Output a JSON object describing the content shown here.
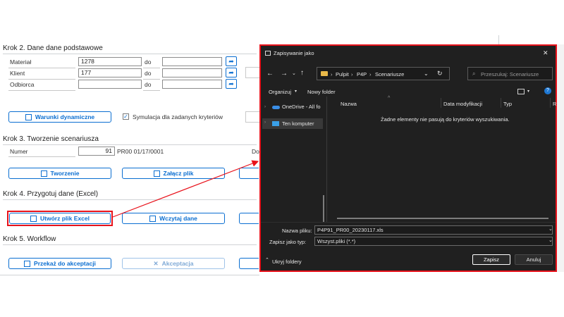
{
  "step2": {
    "title": "Krok 2. Dane dane podstawowe",
    "rows": [
      {
        "label": "Materiał",
        "value": "1278",
        "to_label": "do",
        "to_value": ""
      },
      {
        "label": "Klient",
        "value": "177",
        "to_label": "do",
        "to_value": ""
      },
      {
        "label": "Odbiorca",
        "value": "",
        "to_label": "do",
        "to_value": ""
      }
    ],
    "dynamic_button": "Warunki dynamiczne",
    "simulation_checkbox": "Symulacja dla zadanych kryteriów",
    "simulation_checked": true
  },
  "step3": {
    "title": "Krok 3. Tworzenie scenariusza",
    "number_label": "Numer",
    "number_value": "91",
    "number_text": "PR00 01/17/0001",
    "partial_label": "Do",
    "create_button": "Tworzenie",
    "attach_button": "Załącz plik"
  },
  "step4": {
    "title": "Krok 4. Przygotuj dane (Excel)",
    "create_excel_button": "Utwórz plik Excel",
    "load_button": "Wczytaj dane"
  },
  "step5": {
    "title": "Krok 5. Workflow",
    "forward_button": "Przekaż do akceptacji",
    "accept_button": "Akceptacja"
  },
  "dialog": {
    "title": "Zapisywanie jako",
    "close_glyph": "✕",
    "breadcrumb": [
      "Pulpit",
      "P4P",
      "Scenariusze"
    ],
    "search_placeholder": "Przeszukaj: Scenariusze",
    "organize": "Organizuj",
    "new_folder": "Nowy folder",
    "nav": [
      {
        "label": "OneDrive - All fo"
      },
      {
        "label": "Ten komputer"
      }
    ],
    "columns": [
      "Nazwa",
      "Data modyfikacji",
      "Typ",
      "R"
    ],
    "empty_message": "Żadne elementy nie pasują do kryteriów wyszukiwania.",
    "filename_label": "Nazwa pliku:",
    "filename_value": "P4P91_PR00_20230117.xls",
    "filetype_label": "Zapisz jako typ:",
    "filetype_value": "Wszyst.pliki (*.*)",
    "hide_folders": "Ukryj foldery",
    "save_button": "Zapisz",
    "cancel_button": "Anuluj"
  },
  "colors": {
    "accent": "#0a6ed1",
    "highlight": "#e8121b",
    "dialog_bg": "#202020"
  }
}
